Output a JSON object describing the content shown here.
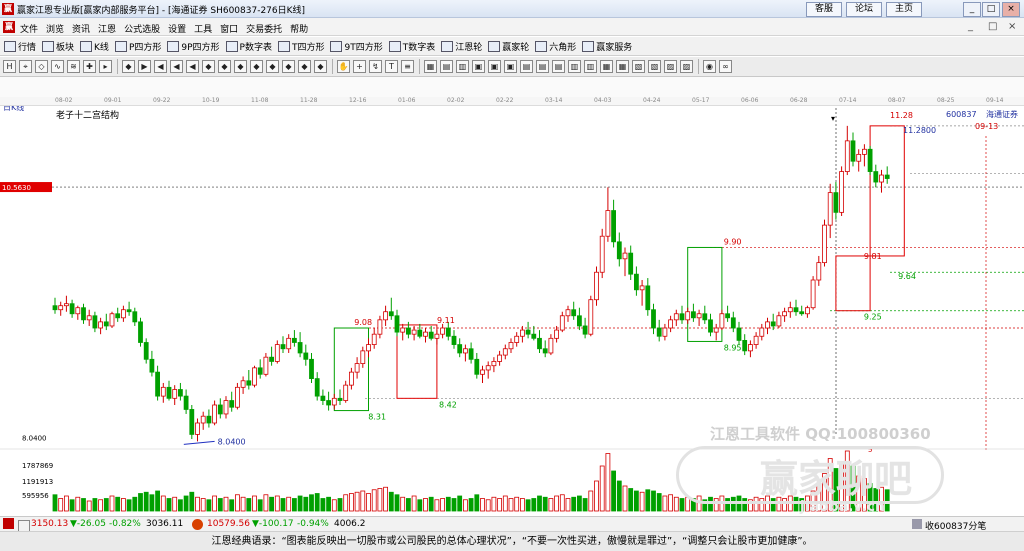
{
  "window": {
    "title": "赢家江恩专业版[赢家内部服务平台] - [海通证券  SH600837-276日K线]",
    "buttons": [
      "客服",
      "论坛",
      "主页"
    ],
    "controls": [
      "_",
      "□",
      "×"
    ],
    "menu": [
      "文件",
      "浏览",
      "资讯",
      "江恩",
      "公式选股",
      "设置",
      "工具",
      "窗口",
      "交易委托",
      "帮助"
    ],
    "menu_window_controls": [
      "_",
      "□",
      "×"
    ]
  },
  "funcbar": [
    {
      "icon": "list-icon",
      "label": "行情"
    },
    {
      "icon": "grid-icon",
      "label": "板块"
    },
    {
      "icon": "candle-icon",
      "label": "K线"
    },
    {
      "icon": "p-square-icon",
      "label": "P四方形"
    },
    {
      "icon": "9p-square-icon",
      "label": "9P四方形"
    },
    {
      "icon": "pn-square-icon",
      "label": "P数字表"
    },
    {
      "icon": "t-square-icon",
      "label": "T四方形"
    },
    {
      "icon": "9t-square-icon",
      "label": "9T四方形"
    },
    {
      "icon": "tn-square-icon",
      "label": "T数字表"
    },
    {
      "icon": "gann-wheel-icon",
      "label": "江恩轮"
    },
    {
      "icon": "winner-wheel-icon",
      "label": "赢家轮"
    },
    {
      "icon": "hexagon-icon",
      "label": "六角形"
    },
    {
      "icon": "service-icon",
      "label": "赢家服务"
    }
  ],
  "toolbar_icons": [
    "H",
    "⌖",
    "◇",
    "∿",
    "≋",
    "✚",
    "▸",
    "◆",
    "▶",
    "◀",
    "◀",
    "◀",
    "◆",
    "◆",
    "◆",
    "◆",
    "◆",
    "◆",
    "◆",
    "◆",
    "✋",
    "+",
    "↯",
    "T",
    "≡",
    "▦",
    "▤",
    "▥",
    "▣",
    "▣",
    "▣",
    "▤",
    "▤",
    "▤",
    "▥",
    "▥",
    "▦",
    "▦",
    "▧",
    "▧",
    "▨",
    "▨",
    "◉",
    "∞"
  ],
  "date_ticks": [
    "08-02",
    "09-01",
    "09-22",
    "10-19",
    "11-08",
    "11-28",
    "12-16",
    "01-06",
    "02-02",
    "02-22",
    "03-14",
    "04-03",
    "04-24",
    "05-17",
    "06-06",
    "06-28",
    "07-14",
    "08-07",
    "08-25",
    "09-14"
  ],
  "chart": {
    "period_label": "日K线",
    "structure_label": "老子十二宫结构",
    "stock_code": "600837",
    "stock_name": "海通证券",
    "cursor_date": "2023-07-14",
    "target_date": "09-13",
    "price_marker": "10.5630",
    "low_label": "8.0400",
    "axis_low": "8.0400",
    "top_price_labels": [
      "11.28",
      "11.2800"
    ],
    "levels": [
      "9.08",
      "9.11",
      "8.42",
      "8.31",
      "9.90",
      "8.95",
      "9.81",
      "9.64",
      "9.25"
    ],
    "volume_ticks": [
      "1787869",
      "1191913",
      "595956"
    ],
    "volume_marker": "5",
    "watermark_1": "江恩工具软件   QQ:100800360",
    "watermark_2": "赢家聊吧",
    "watermark_3": "jiaoba.v.cn"
  },
  "chart_data": {
    "type": "candlestick",
    "ylim": [
      8.0,
      11.4
    ],
    "price_scale": "log",
    "candles": [
      {
        "o": 9.3,
        "h": 9.38,
        "l": 9.22,
        "c": 9.26
      },
      {
        "o": 9.26,
        "h": 9.34,
        "l": 9.2,
        "c": 9.3
      },
      {
        "o": 9.3,
        "h": 9.4,
        "l": 9.24,
        "c": 9.32
      },
      {
        "o": 9.32,
        "h": 9.36,
        "l": 9.18,
        "c": 9.22
      },
      {
        "o": 9.22,
        "h": 9.3,
        "l": 9.16,
        "c": 9.28
      },
      {
        "o": 9.28,
        "h": 9.32,
        "l": 9.12,
        "c": 9.16
      },
      {
        "o": 9.16,
        "h": 9.26,
        "l": 9.1,
        "c": 9.2
      },
      {
        "o": 9.2,
        "h": 9.24,
        "l": 9.04,
        "c": 9.08
      },
      {
        "o": 9.08,
        "h": 9.18,
        "l": 9.02,
        "c": 9.14
      },
      {
        "o": 9.14,
        "h": 9.22,
        "l": 9.06,
        "c": 9.1
      },
      {
        "o": 9.1,
        "h": 9.24,
        "l": 9.08,
        "c": 9.22
      },
      {
        "o": 9.22,
        "h": 9.28,
        "l": 9.14,
        "c": 9.18
      },
      {
        "o": 9.18,
        "h": 9.3,
        "l": 9.14,
        "c": 9.26
      },
      {
        "o": 9.26,
        "h": 9.34,
        "l": 9.2,
        "c": 9.24
      },
      {
        "o": 9.24,
        "h": 9.28,
        "l": 9.1,
        "c": 9.14
      },
      {
        "o": 9.14,
        "h": 9.18,
        "l": 8.9,
        "c": 8.94
      },
      {
        "o": 8.94,
        "h": 8.98,
        "l": 8.74,
        "c": 8.78
      },
      {
        "o": 8.78,
        "h": 8.86,
        "l": 8.62,
        "c": 8.66
      },
      {
        "o": 8.66,
        "h": 8.72,
        "l": 8.4,
        "c": 8.44
      },
      {
        "o": 8.44,
        "h": 8.56,
        "l": 8.38,
        "c": 8.52
      },
      {
        "o": 8.52,
        "h": 8.58,
        "l": 8.4,
        "c": 8.42
      },
      {
        "o": 8.42,
        "h": 8.54,
        "l": 8.36,
        "c": 8.5
      },
      {
        "o": 8.5,
        "h": 8.56,
        "l": 8.4,
        "c": 8.44
      },
      {
        "o": 8.44,
        "h": 8.5,
        "l": 8.28,
        "c": 8.32
      },
      {
        "o": 8.32,
        "h": 8.36,
        "l": 8.06,
        "c": 8.1
      },
      {
        "o": 8.1,
        "h": 8.24,
        "l": 8.04,
        "c": 8.2
      },
      {
        "o": 8.2,
        "h": 8.3,
        "l": 8.14,
        "c": 8.26
      },
      {
        "o": 8.26,
        "h": 8.32,
        "l": 8.16,
        "c": 8.2
      },
      {
        "o": 8.2,
        "h": 8.4,
        "l": 8.18,
        "c": 8.36
      },
      {
        "o": 8.36,
        "h": 8.42,
        "l": 8.24,
        "c": 8.28
      },
      {
        "o": 8.28,
        "h": 8.44,
        "l": 8.24,
        "c": 8.4
      },
      {
        "o": 8.4,
        "h": 8.48,
        "l": 8.3,
        "c": 8.34
      },
      {
        "o": 8.34,
        "h": 8.56,
        "l": 8.32,
        "c": 8.52
      },
      {
        "o": 8.52,
        "h": 8.62,
        "l": 8.46,
        "c": 8.58
      },
      {
        "o": 8.58,
        "h": 8.68,
        "l": 8.5,
        "c": 8.54
      },
      {
        "o": 8.54,
        "h": 8.72,
        "l": 8.52,
        "c": 8.7
      },
      {
        "o": 8.7,
        "h": 8.78,
        "l": 8.6,
        "c": 8.64
      },
      {
        "o": 8.64,
        "h": 8.84,
        "l": 8.62,
        "c": 8.8
      },
      {
        "o": 8.8,
        "h": 8.9,
        "l": 8.72,
        "c": 8.76
      },
      {
        "o": 8.76,
        "h": 8.96,
        "l": 8.74,
        "c": 8.92
      },
      {
        "o": 8.92,
        "h": 9.0,
        "l": 8.84,
        "c": 8.88
      },
      {
        "o": 8.88,
        "h": 9.02,
        "l": 8.84,
        "c": 8.98
      },
      {
        "o": 8.98,
        "h": 9.06,
        "l": 8.9,
        "c": 8.94
      },
      {
        "o": 8.94,
        "h": 9.04,
        "l": 8.8,
        "c": 8.84
      },
      {
        "o": 8.84,
        "h": 8.92,
        "l": 8.72,
        "c": 8.78
      },
      {
        "o": 8.78,
        "h": 8.84,
        "l": 8.56,
        "c": 8.6
      },
      {
        "o": 8.6,
        "h": 8.66,
        "l": 8.4,
        "c": 8.44
      },
      {
        "o": 8.44,
        "h": 8.5,
        "l": 8.36,
        "c": 8.4
      },
      {
        "o": 8.4,
        "h": 8.48,
        "l": 8.31,
        "c": 8.36
      },
      {
        "o": 8.36,
        "h": 8.46,
        "l": 8.32,
        "c": 8.42
      },
      {
        "o": 8.42,
        "h": 8.5,
        "l": 8.36,
        "c": 8.4
      },
      {
        "o": 8.4,
        "h": 8.58,
        "l": 8.38,
        "c": 8.54
      },
      {
        "o": 8.54,
        "h": 8.7,
        "l": 8.5,
        "c": 8.66
      },
      {
        "o": 8.66,
        "h": 8.8,
        "l": 8.6,
        "c": 8.74
      },
      {
        "o": 8.74,
        "h": 8.9,
        "l": 8.7,
        "c": 8.86
      },
      {
        "o": 8.86,
        "h": 8.98,
        "l": 8.8,
        "c": 8.92
      },
      {
        "o": 8.92,
        "h": 9.08,
        "l": 8.88,
        "c": 9.02
      },
      {
        "o": 9.02,
        "h": 9.2,
        "l": 8.98,
        "c": 9.16
      },
      {
        "o": 9.16,
        "h": 9.3,
        "l": 9.1,
        "c": 9.24
      },
      {
        "o": 9.24,
        "h": 9.38,
        "l": 9.16,
        "c": 9.2
      },
      {
        "o": 9.2,
        "h": 9.26,
        "l": 9.0,
        "c": 9.04
      },
      {
        "o": 9.04,
        "h": 9.12,
        "l": 8.96,
        "c": 9.08
      },
      {
        "o": 9.08,
        "h": 9.14,
        "l": 8.98,
        "c": 9.02
      },
      {
        "o": 9.02,
        "h": 9.1,
        "l": 8.96,
        "c": 9.06
      },
      {
        "o": 9.06,
        "h": 9.12,
        "l": 8.98,
        "c": 9.0
      },
      {
        "o": 9.0,
        "h": 9.08,
        "l": 8.94,
        "c": 9.04
      },
      {
        "o": 9.04,
        "h": 9.1,
        "l": 8.96,
        "c": 8.98
      },
      {
        "o": 8.98,
        "h": 9.06,
        "l": 8.92,
        "c": 9.02
      },
      {
        "o": 9.02,
        "h": 9.12,
        "l": 8.98,
        "c": 9.08
      },
      {
        "o": 9.08,
        "h": 9.14,
        "l": 8.96,
        "c": 9.0
      },
      {
        "o": 9.0,
        "h": 9.06,
        "l": 8.88,
        "c": 8.92
      },
      {
        "o": 8.92,
        "h": 8.98,
        "l": 8.8,
        "c": 8.84
      },
      {
        "o": 8.84,
        "h": 8.92,
        "l": 8.76,
        "c": 8.88
      },
      {
        "o": 8.88,
        "h": 8.94,
        "l": 8.74,
        "c": 8.78
      },
      {
        "o": 8.78,
        "h": 8.84,
        "l": 8.6,
        "c": 8.64
      },
      {
        "o": 8.64,
        "h": 8.72,
        "l": 8.56,
        "c": 8.68
      },
      {
        "o": 8.68,
        "h": 8.76,
        "l": 8.6,
        "c": 8.72
      },
      {
        "o": 8.72,
        "h": 8.8,
        "l": 8.66,
        "c": 8.76
      },
      {
        "o": 8.76,
        "h": 8.86,
        "l": 8.72,
        "c": 8.82
      },
      {
        "o": 8.82,
        "h": 8.92,
        "l": 8.78,
        "c": 8.88
      },
      {
        "o": 8.88,
        "h": 8.98,
        "l": 8.84,
        "c": 8.94
      },
      {
        "o": 8.94,
        "h": 9.04,
        "l": 8.9,
        "c": 9.0
      },
      {
        "o": 9.0,
        "h": 9.1,
        "l": 8.94,
        "c": 9.06
      },
      {
        "o": 9.06,
        "h": 9.14,
        "l": 8.98,
        "c": 9.02
      },
      {
        "o": 9.02,
        "h": 9.1,
        "l": 8.96,
        "c": 8.98
      },
      {
        "o": 8.98,
        "h": 9.06,
        "l": 8.84,
        "c": 8.88
      },
      {
        "o": 8.88,
        "h": 8.96,
        "l": 8.8,
        "c": 8.84
      },
      {
        "o": 8.84,
        "h": 9.02,
        "l": 8.82,
        "c": 8.98
      },
      {
        "o": 8.98,
        "h": 9.1,
        "l": 8.94,
        "c": 9.06
      },
      {
        "o": 9.06,
        "h": 9.24,
        "l": 9.04,
        "c": 9.2
      },
      {
        "o": 9.2,
        "h": 9.3,
        "l": 9.14,
        "c": 9.26
      },
      {
        "o": 9.26,
        "h": 9.34,
        "l": 9.16,
        "c": 9.2
      },
      {
        "o": 9.2,
        "h": 9.28,
        "l": 9.06,
        "c": 9.1
      },
      {
        "o": 9.1,
        "h": 9.18,
        "l": 8.98,
        "c": 9.02
      },
      {
        "o": 9.02,
        "h": 9.4,
        "l": 9.0,
        "c": 9.36
      },
      {
        "o": 9.36,
        "h": 9.7,
        "l": 9.3,
        "c": 9.64
      },
      {
        "o": 9.64,
        "h": 10.1,
        "l": 9.58,
        "c": 10.02
      },
      {
        "o": 10.02,
        "h": 10.56,
        "l": 9.96,
        "c": 10.3
      },
      {
        "o": 10.3,
        "h": 10.42,
        "l": 9.9,
        "c": 9.96
      },
      {
        "o": 9.96,
        "h": 10.06,
        "l": 9.7,
        "c": 9.78
      },
      {
        "o": 9.78,
        "h": 9.9,
        "l": 9.6,
        "c": 9.84
      },
      {
        "o": 9.84,
        "h": 9.92,
        "l": 9.56,
        "c": 9.62
      },
      {
        "o": 9.62,
        "h": 9.7,
        "l": 9.4,
        "c": 9.46
      },
      {
        "o": 9.46,
        "h": 9.56,
        "l": 9.3,
        "c": 9.5
      },
      {
        "o": 9.5,
        "h": 9.58,
        "l": 9.2,
        "c": 9.26
      },
      {
        "o": 9.26,
        "h": 9.32,
        "l": 9.02,
        "c": 9.08
      },
      {
        "o": 9.08,
        "h": 9.16,
        "l": 8.95,
        "c": 9.0
      },
      {
        "o": 9.0,
        "h": 9.12,
        "l": 8.96,
        "c": 9.08
      },
      {
        "o": 9.08,
        "h": 9.2,
        "l": 9.04,
        "c": 9.16
      },
      {
        "o": 9.16,
        "h": 9.26,
        "l": 9.1,
        "c": 9.22
      },
      {
        "o": 9.22,
        "h": 9.3,
        "l": 9.12,
        "c": 9.16
      },
      {
        "o": 9.16,
        "h": 9.28,
        "l": 9.12,
        "c": 9.24
      },
      {
        "o": 9.24,
        "h": 9.32,
        "l": 9.14,
        "c": 9.18
      },
      {
        "o": 9.18,
        "h": 9.26,
        "l": 9.1,
        "c": 9.22
      },
      {
        "o": 9.22,
        "h": 9.3,
        "l": 9.12,
        "c": 9.16
      },
      {
        "o": 9.16,
        "h": 9.22,
        "l": 9.0,
        "c": 9.04
      },
      {
        "o": 9.04,
        "h": 9.12,
        "l": 8.96,
        "c": 9.08
      },
      {
        "o": 9.08,
        "h": 9.26,
        "l": 9.06,
        "c": 9.22
      },
      {
        "o": 9.22,
        "h": 9.3,
        "l": 9.14,
        "c": 9.18
      },
      {
        "o": 9.18,
        "h": 9.24,
        "l": 9.04,
        "c": 9.08
      },
      {
        "o": 9.08,
        "h": 9.14,
        "l": 8.92,
        "c": 8.96
      },
      {
        "o": 8.96,
        "h": 9.02,
        "l": 8.82,
        "c": 8.86
      },
      {
        "o": 8.86,
        "h": 8.96,
        "l": 8.8,
        "c": 8.92
      },
      {
        "o": 8.92,
        "h": 9.04,
        "l": 8.88,
        "c": 9.0
      },
      {
        "o": 9.0,
        "h": 9.12,
        "l": 8.96,
        "c": 9.08
      },
      {
        "o": 9.08,
        "h": 9.18,
        "l": 9.02,
        "c": 9.14
      },
      {
        "o": 9.14,
        "h": 9.22,
        "l": 9.06,
        "c": 9.1
      },
      {
        "o": 9.1,
        "h": 9.24,
        "l": 9.08,
        "c": 9.2
      },
      {
        "o": 9.2,
        "h": 9.28,
        "l": 9.14,
        "c": 9.24
      },
      {
        "o": 9.24,
        "h": 9.34,
        "l": 9.18,
        "c": 9.28
      },
      {
        "o": 9.28,
        "h": 9.36,
        "l": 9.2,
        "c": 9.24
      },
      {
        "o": 9.24,
        "h": 9.3,
        "l": 9.2,
        "c": 9.22
      },
      {
        "o": 9.22,
        "h": 9.3,
        "l": 9.18,
        "c": 9.28
      },
      {
        "o": 9.28,
        "h": 9.6,
        "l": 9.26,
        "c": 9.56
      },
      {
        "o": 9.56,
        "h": 9.81,
        "l": 9.5,
        "c": 9.74
      },
      {
        "o": 9.74,
        "h": 10.2,
        "l": 9.7,
        "c": 10.14
      },
      {
        "o": 10.14,
        "h": 10.6,
        "l": 10.0,
        "c": 10.5
      },
      {
        "o": 10.5,
        "h": 10.62,
        "l": 10.2,
        "c": 10.28
      },
      {
        "o": 10.28,
        "h": 10.8,
        "l": 10.24,
        "c": 10.74
      },
      {
        "o": 10.74,
        "h": 11.28,
        "l": 10.7,
        "c": 11.1
      },
      {
        "o": 11.1,
        "h": 11.2,
        "l": 10.8,
        "c": 10.86
      },
      {
        "o": 10.86,
        "h": 11.0,
        "l": 10.74,
        "c": 10.94
      },
      {
        "o": 10.94,
        "h": 11.06,
        "l": 10.8,
        "c": 11.0
      },
      {
        "o": 11.0,
        "h": 11.04,
        "l": 10.7,
        "c": 10.74
      },
      {
        "o": 10.74,
        "h": 10.82,
        "l": 10.56,
        "c": 10.62
      },
      {
        "o": 10.62,
        "h": 10.76,
        "l": 10.5,
        "c": 10.7
      },
      {
        "o": 10.7,
        "h": 10.8,
        "l": 10.6,
        "c": 10.66
      }
    ],
    "volumes": [
      1.3,
      1.0,
      1.2,
      0.9,
      1.1,
      1.0,
      0.8,
      1.0,
      0.9,
      1.0,
      1.2,
      1.1,
      1.0,
      0.9,
      1.1,
      1.4,
      1.5,
      1.3,
      1.6,
      1.2,
      1.0,
      1.1,
      0.9,
      1.2,
      1.5,
      1.1,
      1.0,
      0.9,
      1.2,
      1.0,
      1.1,
      0.9,
      1.3,
      1.1,
      1.0,
      1.2,
      0.9,
      1.3,
      1.1,
      1.2,
      1.0,
      1.1,
      1.0,
      1.2,
      1.1,
      1.3,
      1.4,
      1.0,
      1.1,
      0.9,
      1.0,
      1.3,
      1.4,
      1.5,
      1.6,
      1.4,
      1.7,
      1.8,
      1.9,
      1.5,
      1.3,
      1.1,
      1.0,
      1.2,
      0.9,
      1.0,
      1.1,
      0.9,
      1.0,
      1.1,
      1.0,
      1.2,
      0.9,
      1.0,
      1.3,
      1.0,
      0.9,
      1.1,
      1.0,
      1.2,
      1.0,
      1.1,
      1.0,
      0.9,
      1.0,
      1.2,
      1.1,
      1.0,
      1.2,
      1.3,
      1.0,
      1.1,
      1.2,
      1.0,
      1.6,
      2.4,
      3.6,
      4.6,
      3.2,
      2.4,
      2.0,
      1.8,
      1.6,
      1.5,
      1.7,
      1.6,
      1.4,
      1.2,
      1.3,
      1.1,
      1.0,
      1.1,
      1.0,
      1.2,
      0.9,
      1.1,
      1.0,
      1.2,
      1.0,
      1.1,
      1.2,
      1.0,
      0.9,
      1.1,
      1.0,
      1.2,
      1.0,
      1.1,
      1.0,
      1.2,
      1.1,
      1.0,
      1.2,
      1.6,
      2.2,
      3.0,
      4.2,
      3.4,
      3.8,
      4.8,
      3.6,
      2.8,
      2.6,
      2.2,
      1.8,
      1.9,
      1.7
    ]
  },
  "status": {
    "sh_index": "3150.13",
    "sh_change": "▼-26.05",
    "sh_pct": "-0.82%",
    "sh_amount": "3036.11",
    "sz_index": "10579.56",
    "sz_change": "▼-100.17",
    "sz_pct": "-0.94%",
    "sz_amount": "4006.2",
    "right": "收600837分笔"
  },
  "quote": "江恩经典语录：“图表能反映出一切股市或公司股民的总体心理状况”，“不要一次性买进，傲慢就是罪过”，“调整只会让股市更加健康”。",
  "colors": {
    "up": "#d40000",
    "down": "#00a000",
    "red_box": "#e00000",
    "green_box": "#00a000"
  }
}
